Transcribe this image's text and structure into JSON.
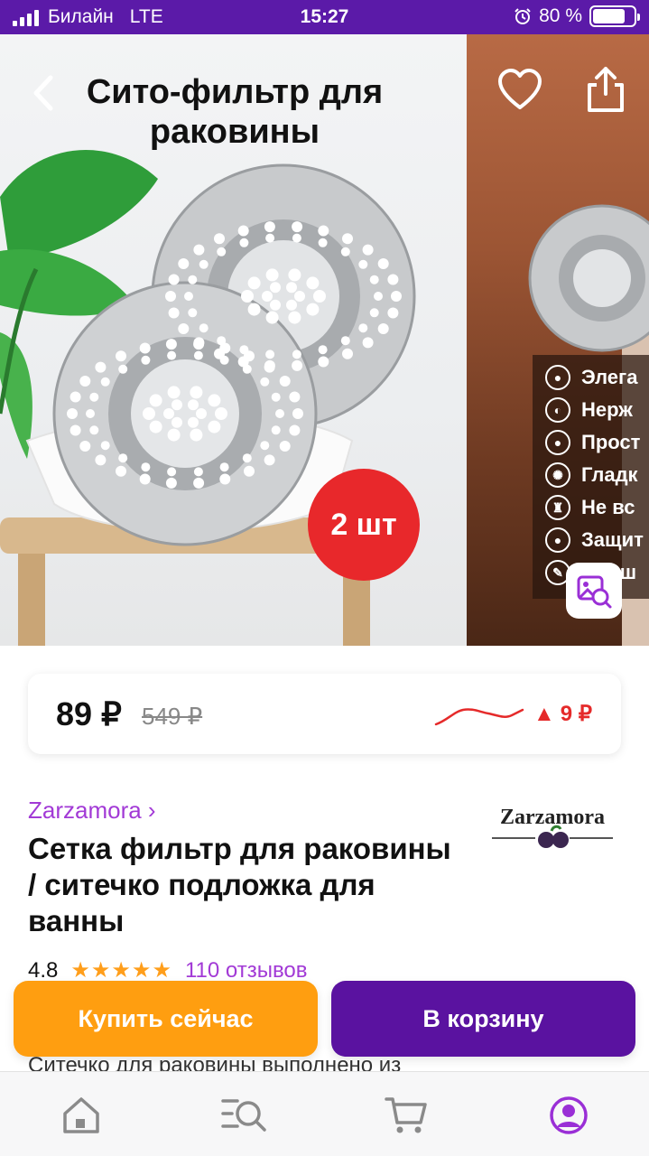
{
  "status_bar": {
    "carrier": "Билайн",
    "network": "LTE",
    "time": "15:27",
    "battery_text": "80 %",
    "battery_level": 0.8
  },
  "gallery": {
    "title": "Сито-фильтр для раковины",
    "badge": "2 шт",
    "features": [
      "Элега",
      "Нерж",
      "Прост",
      "Гладк",
      "Не вс",
      "Защит",
      "Долш"
    ]
  },
  "price": {
    "current": "89 ₽",
    "old": "549 ₽",
    "change": "9 ₽",
    "change_color": "#e52a2a"
  },
  "product": {
    "brand_link": "Zarzamora ›",
    "brand_logo_text": "Zarzamora",
    "title": "Сетка фильтр для раковины / ситечко подложка для ванны",
    "rating": "4.8",
    "stars": "★★★★★",
    "reviews": "110 отзывов",
    "description_preview": "Ситечко для раковины выполнено из"
  },
  "actions": {
    "buy_now": "Купить сейчас",
    "add_to_cart": "В корзину"
  },
  "colors": {
    "accent": "#5a12a0",
    "brand_link": "#a23ad6",
    "buy_now": "#ff9e10",
    "star": "#ff9e1b"
  },
  "tabbar": {
    "items": [
      "home-icon",
      "catalog-search-icon",
      "cart-icon",
      "profile-icon"
    ],
    "active": "profile-icon"
  }
}
